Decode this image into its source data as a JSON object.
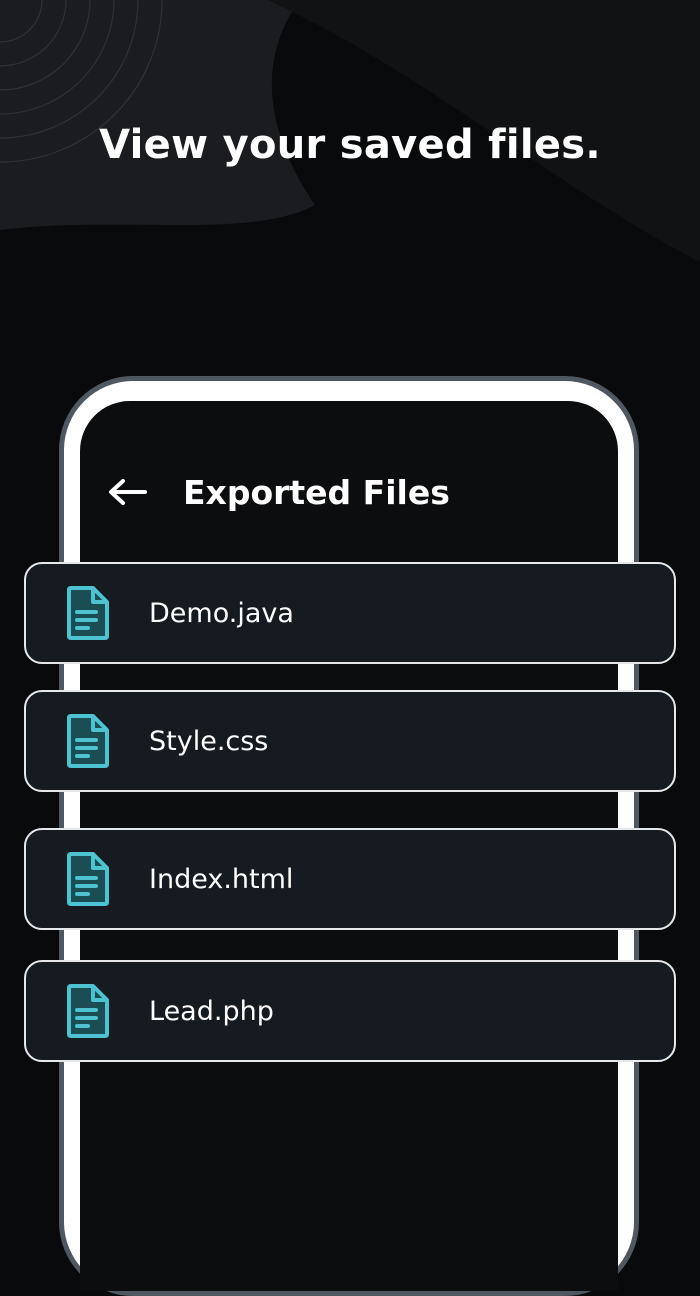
{
  "headline": "View your saved files.",
  "app": {
    "title": "Exported Files",
    "back_icon": "arrow-left-icon"
  },
  "files": [
    {
      "name": "Demo.java",
      "icon": "document-icon"
    },
    {
      "name": "Style.css",
      "icon": "document-icon"
    },
    {
      "name": "Index.html",
      "icon": "document-icon"
    },
    {
      "name": "Lead.php",
      "icon": "document-icon"
    }
  ],
  "colors": {
    "background": "#080a0c",
    "card": "#161b21",
    "card_border": "#e6e8ea",
    "icon_accent": "#4cc3cf",
    "text": "#ffffff"
  }
}
